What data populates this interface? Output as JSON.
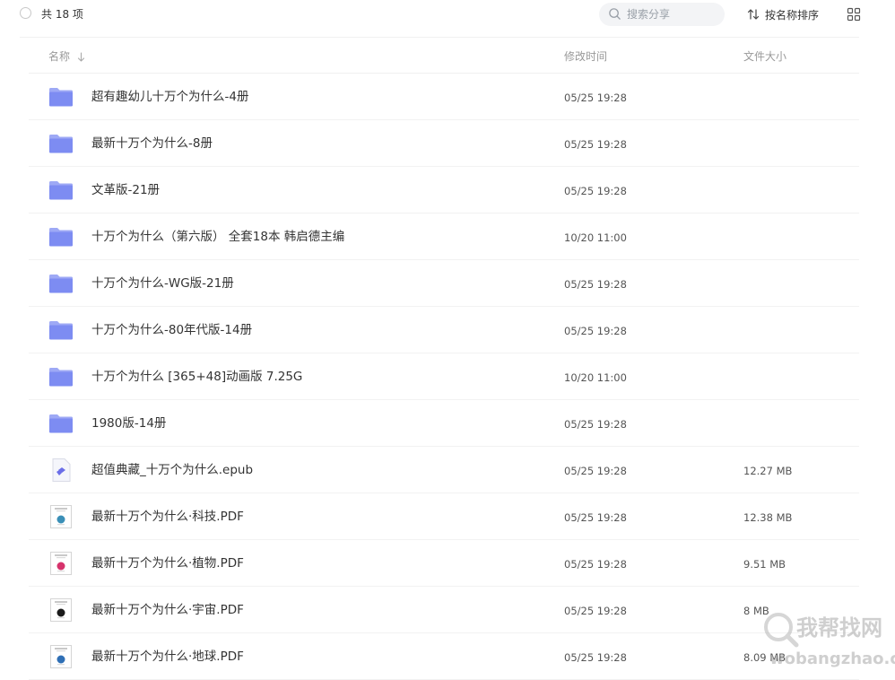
{
  "toolbar": {
    "count_label": "共 18 项",
    "search_placeholder": "搜索分享",
    "sort_label": "按名称排序"
  },
  "columns": {
    "name": "名称",
    "modified": "修改时间",
    "size": "文件大小"
  },
  "files": [
    {
      "name": "超有趣幼儿十万个为什么-4册",
      "modified": "05/25 19:28",
      "size": "",
      "kind": "folder"
    },
    {
      "name": "最新十万个为什么-8册",
      "modified": "05/25 19:28",
      "size": "",
      "kind": "folder"
    },
    {
      "name": "文革版-21册",
      "modified": "05/25 19:28",
      "size": "",
      "kind": "folder"
    },
    {
      "name": "十万个为什么（第六版） 全套18本 韩启德主编",
      "modified": "10/20 11:00",
      "size": "",
      "kind": "folder"
    },
    {
      "name": "十万个为什么-WG版-21册",
      "modified": "05/25 19:28",
      "size": "",
      "kind": "folder"
    },
    {
      "name": "十万个为什么-80年代版-14册",
      "modified": "05/25 19:28",
      "size": "",
      "kind": "folder"
    },
    {
      "name": "十万个为什么 [365+48]动画版 7.25G",
      "modified": "10/20 11:00",
      "size": "",
      "kind": "folder"
    },
    {
      "name": "1980版-14册",
      "modified": "05/25 19:28",
      "size": "",
      "kind": "folder"
    },
    {
      "name": "超值典藏_十万个为什么.epub",
      "modified": "05/25 19:28",
      "size": "12.27 MB",
      "kind": "epub"
    },
    {
      "name": "最新十万个为什么·科技.PDF",
      "modified": "05/25 19:28",
      "size": "12.38 MB",
      "kind": "pdf",
      "thumb_color": "#3a8fb7"
    },
    {
      "name": "最新十万个为什么·植物.PDF",
      "modified": "05/25 19:28",
      "size": "9.51 MB",
      "kind": "pdf",
      "thumb_color": "#d6336c"
    },
    {
      "name": "最新十万个为什么·宇宙.PDF",
      "modified": "05/25 19:28",
      "size": "8 MB",
      "kind": "pdf",
      "thumb_color": "#1a1a1a"
    },
    {
      "name": "最新十万个为什么·地球.PDF",
      "modified": "05/25 19:28",
      "size": "8.09 MB",
      "kind": "pdf",
      "thumb_color": "#2f6fb5"
    }
  ],
  "icons": {
    "folder_color": "#7d8cf2",
    "epub_color": "#6b6ee8"
  },
  "watermark": {
    "cn": "我帮找网",
    "url": "wobangzhao.com"
  }
}
